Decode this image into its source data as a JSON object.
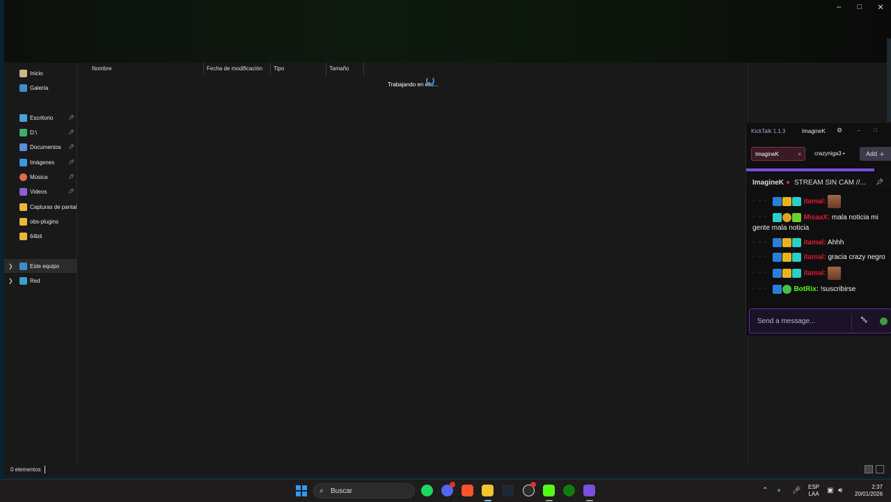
{
  "explorer": {
    "nav": [
      {
        "label": "Inicio",
        "icon": "home-icon",
        "pinned": false
      },
      {
        "label": "Galería",
        "icon": "gallery-icon",
        "pinned": false
      },
      {
        "label": "Escritorio",
        "icon": "desktop-icon",
        "pinned": true
      },
      {
        "label": "D:\\",
        "icon": "download-icon",
        "pinned": true
      },
      {
        "label": "Documentos",
        "icon": "documents-icon",
        "pinned": true
      },
      {
        "label": "Imágenes",
        "icon": "pictures-icon",
        "pinned": true
      },
      {
        "label": "Música",
        "icon": "music-icon",
        "pinned": true
      },
      {
        "label": "Videos",
        "icon": "videos-icon",
        "pinned": true
      },
      {
        "label": "Capturas de pantalla",
        "icon": "folder-icon",
        "pinned": false
      },
      {
        "label": "obs-plugins",
        "icon": "folder-icon",
        "pinned": false
      },
      {
        "label": "64bit",
        "icon": "folder-icon",
        "pinned": false
      },
      {
        "label": "Este equipo",
        "icon": "computer-icon",
        "pinned": false
      },
      {
        "label": "Red",
        "icon": "network-icon",
        "pinned": false
      }
    ],
    "columns": [
      "Nombre",
      "Fecha de modificación",
      "Tipo",
      "Tamaño"
    ],
    "working_text": "Trabajando en ello...",
    "status": "0 elementos"
  },
  "kicktalk": {
    "title": "KickTalk 1.1.3",
    "user": "ImagineK",
    "tabs": [
      {
        "label": "ImagineK",
        "close": "×"
      },
      {
        "label": "crazyniga3"
      }
    ],
    "add_label": "Add",
    "channel": "ImagineK",
    "stream_title": "STREAM SIN CAM //...",
    "messages": [
      {
        "user": "itamal:",
        "text": "",
        "emote": true,
        "color": "#d91c32"
      },
      {
        "user": "MisaaX:",
        "text": "mala noticia mi gente mala noticia",
        "emote": false,
        "color": "#d91c32"
      },
      {
        "user": "itamal:",
        "text": "Ahhh",
        "emote": false,
        "color": "#d91c32"
      },
      {
        "user": "itamal:",
        "text": "gracia crazy negro",
        "emote": false,
        "color": "#d91c32"
      },
      {
        "user": "itamal:",
        "text": "",
        "emote": true,
        "color": "#d91c32"
      },
      {
        "user": "BotRix:",
        "text": "!suscribirse",
        "emote": false,
        "color": "#53fc18"
      }
    ],
    "input_placeholder": "Send a message..."
  },
  "taskbar": {
    "search_label": "Buscar",
    "lang_top": "ESP",
    "lang_bottom": "LAA",
    "time": "2:37",
    "date": "20/01/2026"
  }
}
